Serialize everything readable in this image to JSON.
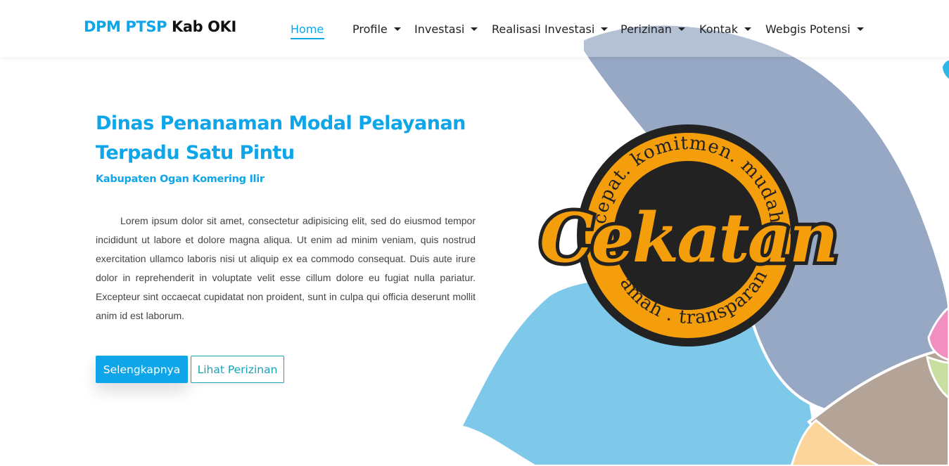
{
  "header": {
    "brand_part1": "DPM PTSP",
    "brand_part2": "Kab OKI",
    "nav": [
      {
        "label": "Home",
        "active": true,
        "dropdown": false
      },
      {
        "label": "Profile",
        "dropdown": true
      },
      {
        "label": "Investasi",
        "dropdown": true
      },
      {
        "label": "Realisasi Investasi",
        "dropdown": true
      },
      {
        "label": "Perizinan",
        "dropdown": true
      },
      {
        "label": "Kontak",
        "dropdown": true
      },
      {
        "label": "Webgis Potensi",
        "dropdown": true
      }
    ]
  },
  "hero": {
    "title_line1": "Dinas Penanaman Modal Pelayanan",
    "title_line2": "Terpadu Satu Pintu",
    "subtitle": "Kabupaten Ogan Komering Ilir",
    "paragraph": "Lorem ipsum dolor sit amet, consectetur adipisicing elit, sed do eiusmod tempor incididunt ut labore et dolore magna aliqua. Ut enim ad minim veniam, quis nostrud exercitation ullamco laboris nisi ut aliquip ex ea commodo consequat. Duis aute irure dolor in reprehenderit in voluptate velit esse cillum dolore eu fugiat nulla pariatur. Excepteur sint occaecat cupidatat non proident, sunt in culpa qui officia deserunt mollit anim id est laborum.",
    "primary_button": "Selengkapnya",
    "secondary_button": "Lihat Perizinan"
  },
  "logo": {
    "wordmark": "Cekatan",
    "arc_top": "cepat. komitmen. mudah",
    "arc_bottom": "ramah . transparan"
  },
  "colors": {
    "accent": "#0ea5e9",
    "outline_button": "#17a2b8",
    "logo_orange": "#f59e0b",
    "logo_dark": "#222222",
    "shape_slate": "#97a8c4",
    "shape_sky": "#7ec8ea",
    "shape_taupe": "#b4a397",
    "shape_peach": "#fbd59b"
  }
}
